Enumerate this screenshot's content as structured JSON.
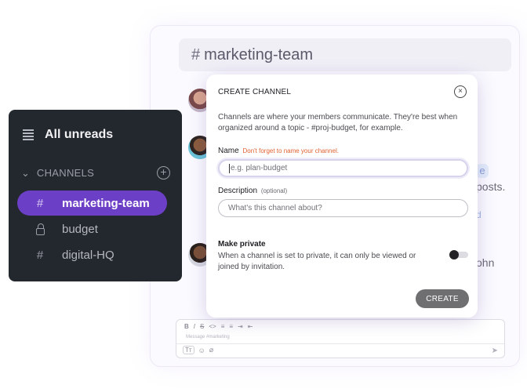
{
  "chat": {
    "channel_hash": "#",
    "channel_name": "marketing-team",
    "peek_e": "e",
    "peek_posts": "posts.",
    "peek_d": "d",
    "peek_john": "ohn",
    "composer": {
      "format_icons": [
        "B",
        "I",
        "S",
        "<>",
        "list",
        "list",
        "indent",
        "outdent"
      ],
      "placeholder": "Message #marketing",
      "tt_label": "Tт",
      "emoji_icon": "☺",
      "attach_icon": "⌀",
      "send_icon": "➤"
    }
  },
  "sidebar": {
    "all_unreads": "All unreads",
    "channels_label": "CHANNELS",
    "add_icon": "+",
    "items": [
      {
        "icon": "#",
        "label": "marketing-team",
        "active": true
      },
      {
        "icon": "lock",
        "label": "budget",
        "active": false
      },
      {
        "icon": "#",
        "label": "digital-HQ",
        "active": false
      }
    ]
  },
  "modal": {
    "title": "CREATE CHANNEL",
    "close_icon": "×",
    "description": "Channels are where your members communicate. They're best when organized around a topic - #proj-budget, for example.",
    "name_label": "Name",
    "name_hint": "Don't forget to name your channel.",
    "name_placeholder": "e.g. plan-budget",
    "description_label": "Description",
    "description_hint": "(optional)",
    "description_placeholder": "What's this channel about?",
    "private_title": "Make private",
    "private_desc": "When a channel is set to private, it can only be viewed or joined by invitation.",
    "private_enabled": false,
    "create_label": "CREATE"
  },
  "colors": {
    "accent": "#6c3fc7",
    "sidebar_bg": "#23272e",
    "error": "#e0602e",
    "create_button": "#6f6f72"
  }
}
